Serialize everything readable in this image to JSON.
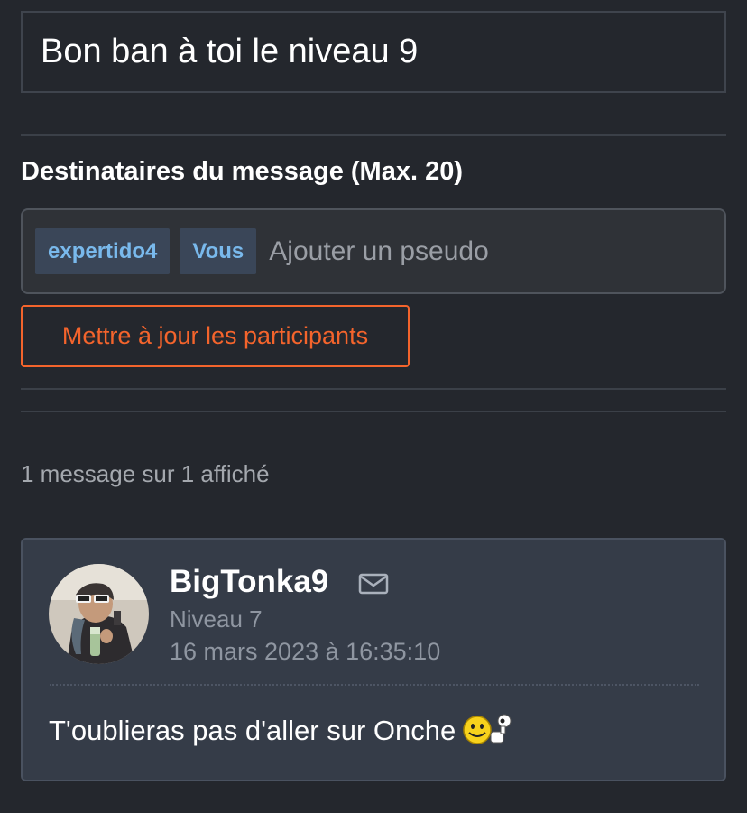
{
  "conversation": {
    "title": "Bon ban à toi le niveau 9"
  },
  "recipients": {
    "heading": "Destinataires du message (Max. 20)",
    "chips": [
      "expertido4",
      "Vous"
    ],
    "add_placeholder": "Ajouter un pseudo",
    "update_button": "Mettre à jour les participants"
  },
  "message_count": "1 message sur 1 affiché",
  "message": {
    "author": "BigTonka9",
    "level": "Niveau 7",
    "timestamp": "16 mars 2023 à 16:35:10",
    "body": "T'oublieras pas d'aller sur Onche",
    "icons": {
      "mail": "mail-icon",
      "emoji": "smiley-emoji-icon"
    }
  },
  "colors": {
    "background": "#24272d",
    "accent": "#f4642c",
    "chip_text": "#79b9ec",
    "card_bg": "#353c48"
  }
}
